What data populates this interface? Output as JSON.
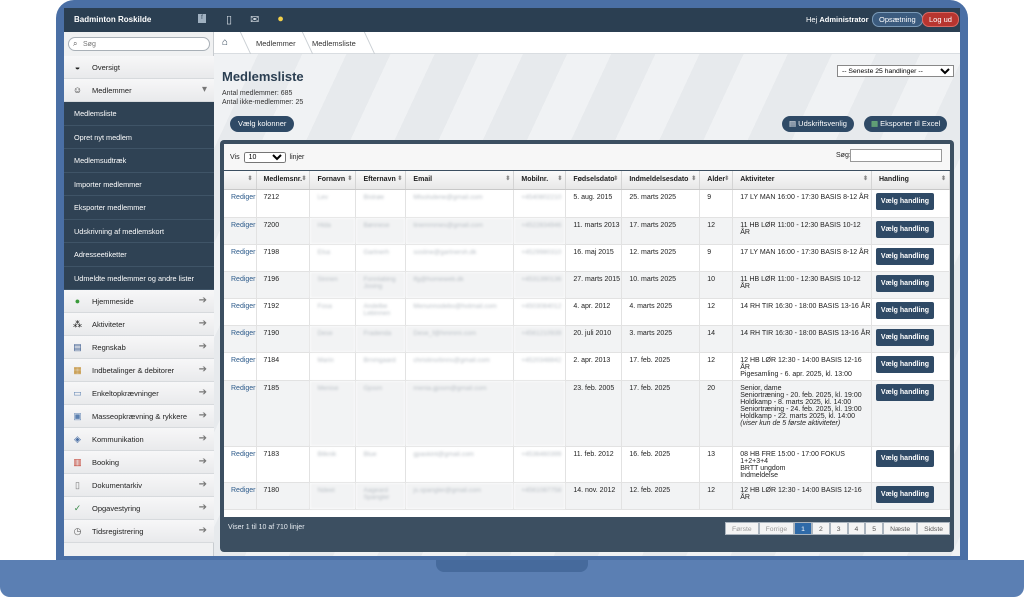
{
  "topbar": {
    "brand": "Badminton Roskilde",
    "greeting": "Hej",
    "user": "Administrator",
    "setup_label": "Opsætning",
    "logout_label": "Log ud"
  },
  "sidebar": {
    "search_placeholder": "Søg",
    "items": [
      {
        "label": "Oversigt",
        "icon": "dashboard-icon"
      },
      {
        "label": "Medlemmer",
        "icon": "members-icon"
      },
      {
        "label": "Hjemmeside",
        "icon": "globe-icon"
      },
      {
        "label": "Aktiviteter",
        "icon": "activities-icon"
      },
      {
        "label": "Regnskab",
        "icon": "ledger-icon"
      },
      {
        "label": "Indbetalinger & debitorer",
        "icon": "payments-icon"
      },
      {
        "label": "Enkeltopkrævninger",
        "icon": "invoice-icon"
      },
      {
        "label": "Masseopkrævning & rykkere",
        "icon": "mass-invoice-icon"
      },
      {
        "label": "Kommunikation",
        "icon": "communication-icon"
      },
      {
        "label": "Booking",
        "icon": "calendar-icon"
      },
      {
        "label": "Dokumentarkiv",
        "icon": "document-icon"
      },
      {
        "label": "Opgavestyring",
        "icon": "tasks-icon"
      },
      {
        "label": "Tidsregistrering",
        "icon": "clock-icon"
      }
    ],
    "submenu": [
      "Medlemsliste",
      "Opret nyt medlem",
      "Medlemsudtræk",
      "Importer medlemmer",
      "Eksporter medlemmer",
      "Udskrivning af medlemskort",
      "Adresseetiketter",
      "Udmeldte medlemmer og andre lister"
    ]
  },
  "breadcrumb": {
    "level1": "Medlemmer",
    "level2": "Medlemsliste"
  },
  "main": {
    "title": "Medlemsliste",
    "count_members": "Antal medlemmer: 685",
    "count_nonmembers": "Antal ikke-medlemmer: 25",
    "recent_actions": "-- Seneste 25 handlinger --",
    "choose_columns": "Vælg kolonner",
    "print_label": "Udskriftsvenlig",
    "excel_label": "Eksporter til Excel"
  },
  "table": {
    "show_prefix": "Vis",
    "show_value": "10",
    "show_suffix": "linjer",
    "search_label": "Søg:",
    "columns": [
      "",
      "Medlemsnr.",
      "Fornavn",
      "Efternavn",
      "Email",
      "Mobilnr.",
      "Fødselsdato",
      "Indmeldelsesdato",
      "Alder",
      "Aktiviteter",
      "Handling"
    ],
    "edit_label": "Rediger",
    "action_label": "Vælg handling",
    "rows": [
      {
        "nr": "7212",
        "first": "Lev",
        "last": "Bistrøe",
        "email": "Mlsolsdene@gmail.com",
        "mobile": "+4540802210",
        "birth": "5. aug. 2015",
        "joined": "25. marts 2025",
        "age": "9",
        "activities": "17 LY MAN 16:00 - 17:30 BASIS 8-12 ÅR"
      },
      {
        "nr": "7200",
        "first": "Hida",
        "last": "Bønnese",
        "email": "linemmmes@gmail.com",
        "mobile": "+4522834946",
        "birth": "11. marts 2013",
        "joined": "17. marts 2025",
        "age": "12",
        "activities": "11 HB LØR 11:00 - 12:30 BASIS 10-12 ÅR"
      },
      {
        "nr": "7198",
        "first": "Elsa",
        "last": "Gartnerh",
        "email": "sosline@gartnersh.dk",
        "mobile": "+4529980310",
        "birth": "16. maj 2015",
        "joined": "12. marts 2025",
        "age": "9",
        "activities": "17 LY MAN 16:00 - 17:30 BASIS 8-12 ÅR"
      },
      {
        "nr": "7196",
        "first": "Sinnen",
        "last": "Fonnlabing Josing",
        "email": "lfg@homeweb.dk",
        "mobile": "+4531390136",
        "birth": "27. marts 2015",
        "joined": "10. marts 2025",
        "age": "10",
        "activities": "11 HB LØR 11:00 - 12:30 BASIS 10-12 ÅR"
      },
      {
        "nr": "7192",
        "first": "Fosa",
        "last": "Andelbe Lebinnen",
        "email": "Menunnodebo@hotmail.com",
        "mobile": "+4503084012",
        "birth": "4. apr. 2012",
        "joined": "4. marts 2025",
        "age": "12",
        "activities": "14 RH TIR 16:30 - 18:00 BASIS 13-16 ÅR"
      },
      {
        "nr": "7190",
        "first": "Dese",
        "last": "Fradenda",
        "email": "Dese_f@hmmmi.com",
        "mobile": "+4561210939",
        "birth": "20. juli 2010",
        "joined": "3. marts 2025",
        "age": "14",
        "activities": "14 RH TIR 16:30 - 18:00 BASIS 13-16 ÅR"
      },
      {
        "nr": "7184",
        "first": "Marin",
        "last": "Brnmgaard",
        "email": "christinsrbnns@gmail.com",
        "mobile": "+4520348842",
        "birth": "2. apr. 2013",
        "joined": "17. feb. 2025",
        "age": "12",
        "activities": "12 HB LØR 12:30 - 14:00 BASIS 12-16 ÅR\nPigesamling - 6. apr. 2025, kl. 13:00"
      },
      {
        "nr": "7185",
        "first": "Menise",
        "last": "Gjosm",
        "email": "menia.gjosm@gmail.com",
        "mobile": "",
        "birth": "23. feb. 2005",
        "joined": "17. feb. 2025",
        "age": "20",
        "activities": "Senior, dame\nSeniortræning - 20. feb. 2025, kl. 19:00\nHoldkamp - 8. marts 2025, kl. 14:00\nSeniortræning - 24. feb. 2025, kl. 19:00\nHoldkamp - 22. marts 2025, kl. 14:00",
        "note": "(viser kun de 5 første aktiviteter)"
      },
      {
        "nr": "7183",
        "first": "Bliknik",
        "last": "Blue",
        "email": "gpaskint@gmail.com",
        "mobile": "+4536460399",
        "birth": "11. feb. 2012",
        "joined": "16. feb. 2025",
        "age": "13",
        "activities": "08 HB FRE 15:00 - 17:00 FOKUS 1+2+3+4\nBRTT ungdom\nIndmeldelse"
      },
      {
        "nr": "7180",
        "first": "Ndeet",
        "last": "Aageard Spangler",
        "email": "js.spangler@gmail.com",
        "mobile": "+4561087758",
        "birth": "14. nov. 2012",
        "joined": "12. feb. 2025",
        "age": "12",
        "activities": "12 HB LØR 12:30 - 14:00 BASIS 12-16 ÅR"
      }
    ],
    "showing": "Viser 1 til 10 af 710 linjer",
    "pager": {
      "first": "Første",
      "prev": "Forrige",
      "pages": [
        "1",
        "2",
        "3",
        "4",
        "5"
      ],
      "next": "Næste",
      "last": "Sidste"
    }
  }
}
